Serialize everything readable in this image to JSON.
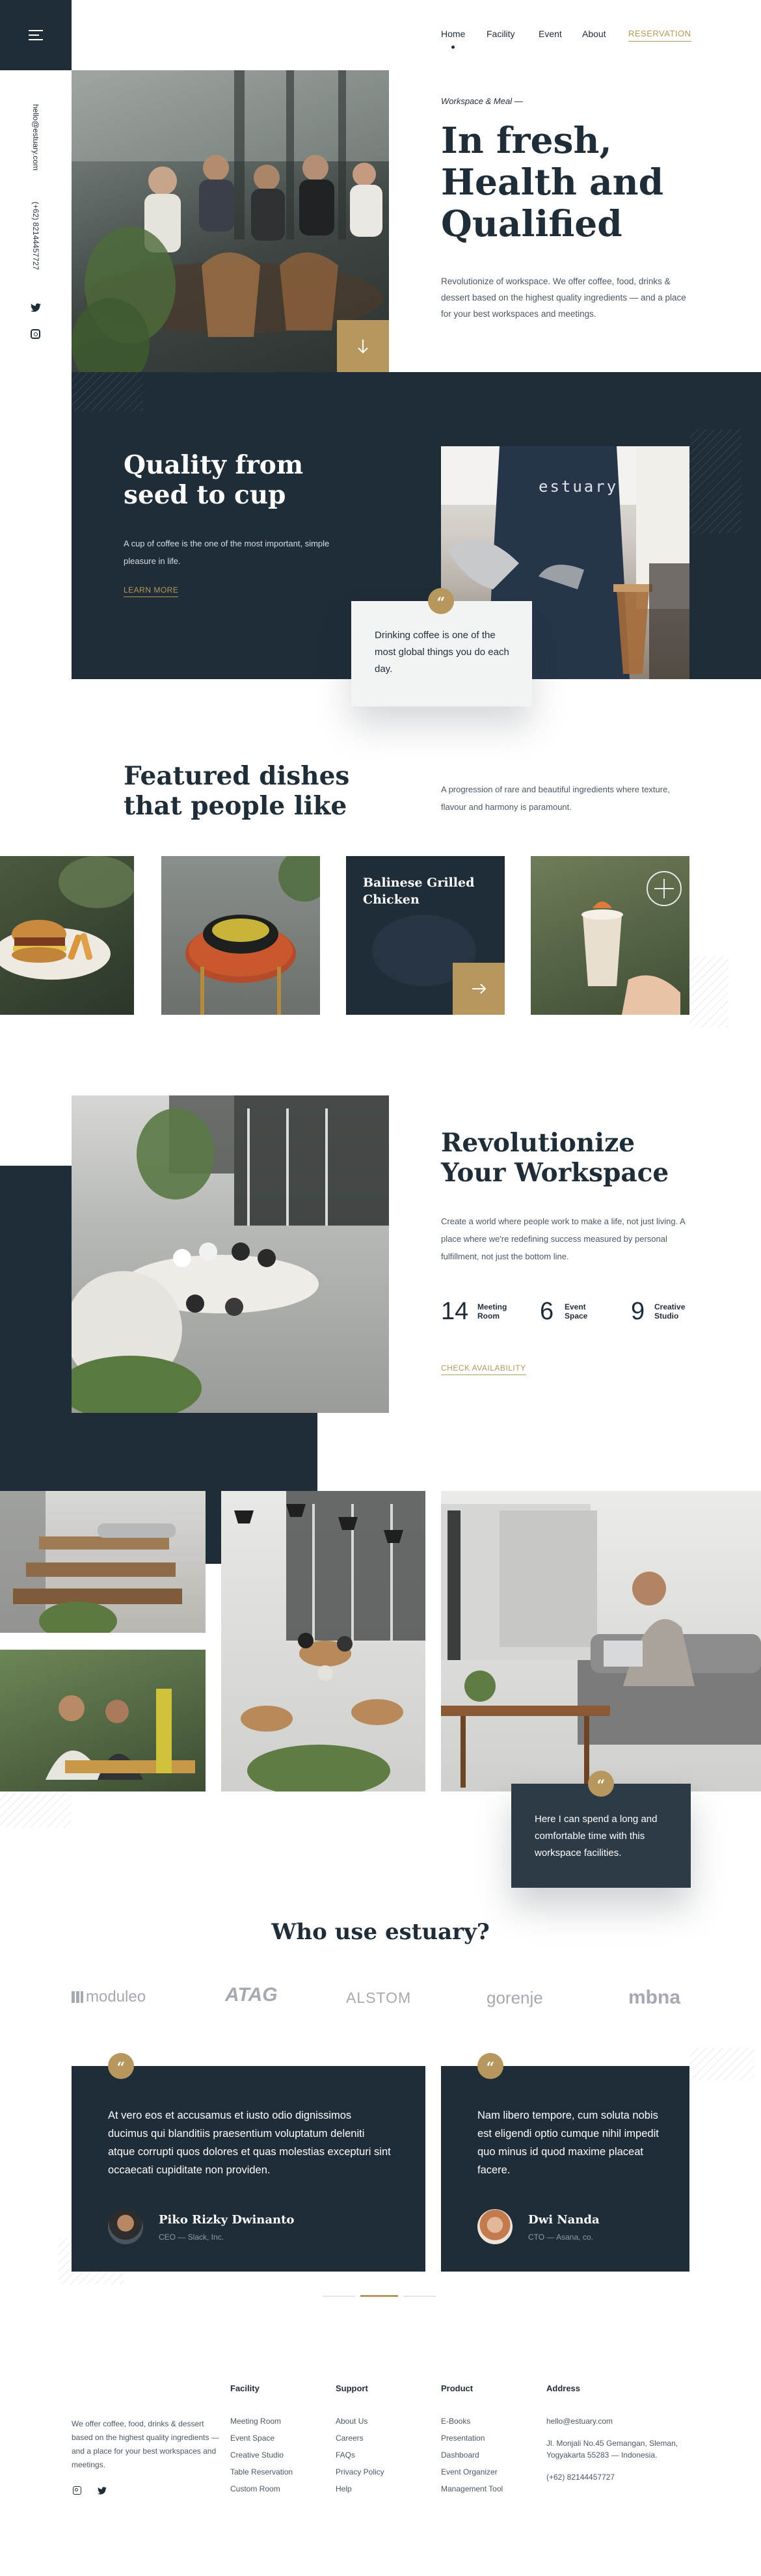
{
  "colors": {
    "navy": "#1f2d38",
    "gold": "#b6975d",
    "text": "#1f2d38",
    "muted": "#6b7680"
  },
  "nav": {
    "menu_icon": "hamburger-icon",
    "links": [
      "Home",
      "Facility",
      "Event",
      "About"
    ],
    "reservation": "RESERVATION",
    "active": "Home"
  },
  "side": {
    "email": "hello@estuary.com",
    "phone": "(+62) 82144457727",
    "icons": [
      "twitter-icon",
      "instagram-icon"
    ]
  },
  "hero": {
    "kicker": "Workspace & Meal —",
    "title_lines": [
      "In fresh,",
      "Health and",
      "Qualified"
    ],
    "description": "Revolutionize of workspace. We offer coffee, food, drinks & dessert based on the highest quality ingredients — and a place for your best workspaces and meetings.",
    "scroll_icon": "arrow-down-icon"
  },
  "quality": {
    "title_lines": [
      "Quality from",
      "seed to cup"
    ],
    "description": "A cup of coffee is the one of the most important, simple pleasure in life.",
    "link": "LEARN MORE",
    "quote": "Drinking coffee is one of the most global things you do each day."
  },
  "featured": {
    "title_lines": [
      "Featured dishes",
      "that people like"
    ],
    "description": "A progression of rare and beautiful ingredients where texture, flavour and harmony is paramount.",
    "card_title_lines": [
      "Balinese Grilled",
      "Chicken"
    ],
    "card_icon": "arrow-right-icon"
  },
  "workspace": {
    "title_lines": [
      "Revolutionize",
      "Your Workspace"
    ],
    "description": "Create a world where people work to make a life, not just living. A place where we're redefining success measured by personal fulfillment, not just the bottom line.",
    "stats": [
      {
        "number": "14",
        "label_lines": [
          "Meeting",
          "Room"
        ]
      },
      {
        "number": "6",
        "label_lines": [
          "Event",
          "Space"
        ]
      },
      {
        "number": "9",
        "label_lines": [
          "Creative",
          "Studio"
        ]
      }
    ],
    "link": "CHECK AVAILABILITY"
  },
  "gallery": {
    "quote": "Here I can spend a long and comfortable time with this workspace facilities."
  },
  "clients": {
    "title": "Who use estuary?",
    "logos": [
      "moduleo",
      "ATAG",
      "ALSTOM",
      "gorenje",
      "mbna"
    ]
  },
  "testimonials": [
    {
      "text": "At vero eos et accusamus et iusto odio dignissimos ducimus qui blanditiis praesentium voluptatum deleniti atque corrupti quos dolores et quas molestias excepturi sint occaecati cupiditate non providen.",
      "name": "Piko Rizky Dwinanto",
      "role": "CEO — Slack, Inc."
    },
    {
      "text": "Nam libero tempore, cum soluta nobis est eligendi optio cumque nihil impedit quo minus id quod maxime placeat facere.",
      "name": "Dwi Nanda",
      "role": "CTO — Asana, co."
    }
  ],
  "slider": {
    "count": 3,
    "active": 1
  },
  "footer": {
    "about": "We offer coffee, food, drinks & dessert based on the highest quality ingredients — and a place for your best workspaces and meetings.",
    "social_icons": [
      "instagram-icon",
      "twitter-icon"
    ],
    "columns": [
      {
        "title": "Facility",
        "links": [
          "Meeting Room",
          "Event Space",
          "Creative Studio",
          "Table Reservation",
          "Custom Room"
        ]
      },
      {
        "title": "Support",
        "links": [
          "About Us",
          "Careers",
          "FAQs",
          "Privacy Policy",
          "Help"
        ]
      },
      {
        "title": "Product",
        "links": [
          "E-Books",
          "Presentation",
          "Dashboard",
          "Event Organizer",
          "Management Tool"
        ]
      }
    ],
    "address": {
      "title": "Address",
      "email": "hello@estuary.com",
      "street": "Jl. Monjali No.45 Gemangan, Sleman,",
      "city": "Yogyakarta 55283 — Indonesia.",
      "phone": "(+62) 82144457727"
    }
  }
}
